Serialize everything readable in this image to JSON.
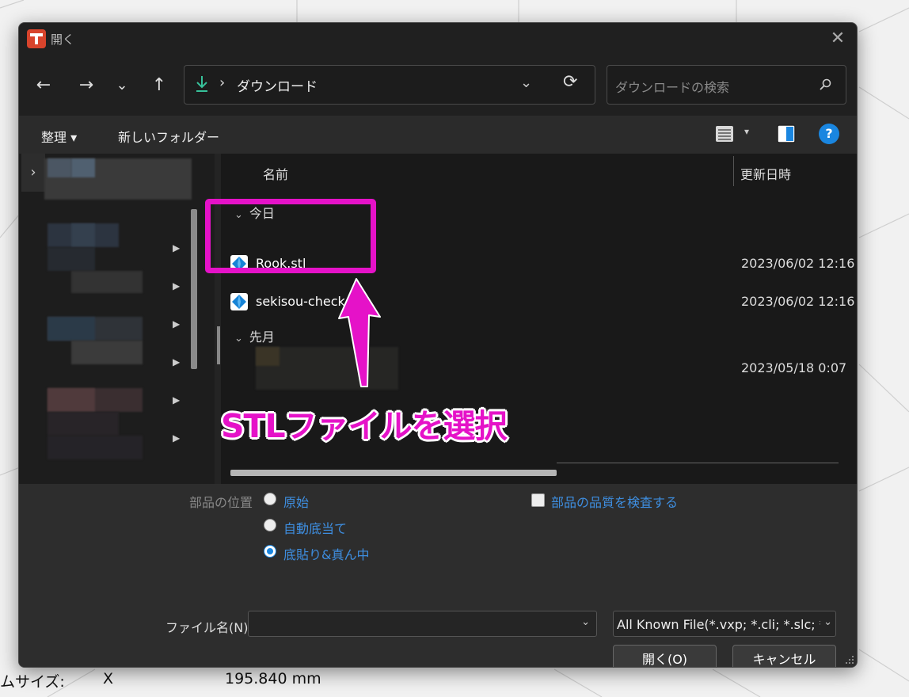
{
  "dialog": {
    "title": "開く",
    "close_glyph": "✕"
  },
  "nav": {
    "back": "←",
    "forward": "→",
    "recent": "⌄",
    "up": "↑",
    "path_chevron": "›",
    "path": "ダウンロード",
    "address_dropdown": "⌄",
    "refresh": "⟳",
    "search_placeholder": "ダウンロードの検索"
  },
  "commandbar": {
    "organize": "整理 ▾",
    "new_folder": "新しいフォルダー",
    "view_dropdown": "▾",
    "help": "?"
  },
  "sidebar": {
    "expand_chevron": "›"
  },
  "filelist": {
    "columns": {
      "name": "名前",
      "modified": "更新日時"
    },
    "groups": [
      {
        "label": "今日",
        "chevron": "⌄"
      },
      {
        "label": "先月",
        "chevron": "⌄"
      }
    ],
    "rows": [
      {
        "name": "Rook.stl",
        "date": "2023/06/02 12:16"
      },
      {
        "name": "sekisou-check.stl",
        "date": "2023/06/02 12:16"
      },
      {
        "name": "",
        "date": "2023/05/18 0:07"
      }
    ]
  },
  "options": {
    "placement_label": "部品の位置",
    "placement_options": [
      "原始",
      "自動底当て",
      "底貼り&真ん中"
    ],
    "selected_placement": "底貼り&真ん中",
    "check_quality_label": "部品の品質を検査する"
  },
  "footer": {
    "filename_label": "ファイル名(N):",
    "filename_value": "",
    "filetype_value": "All Known File(*.vxp; *.cli; *.slc; *",
    "dropdown_glyph": "⌄",
    "open_button": "開く(O)",
    "cancel_button": "キャンセル"
  },
  "background": {
    "status_label": "ムサイズ:",
    "axis": "X",
    "value": "195.840 mm"
  },
  "annotation": {
    "text": "STLファイルを選択",
    "color": "#e512c8"
  }
}
